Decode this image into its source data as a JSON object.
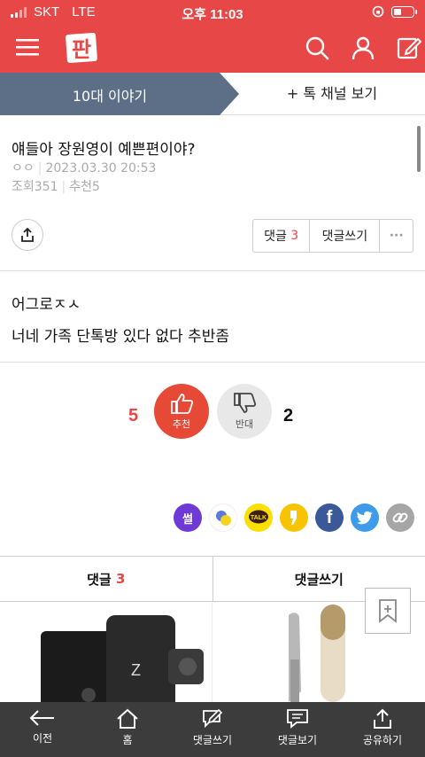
{
  "status": {
    "carrier": "SKT",
    "network": "LTE",
    "time": "오후 11:03"
  },
  "tabs": {
    "active": "10대 이야기",
    "other": "+ 톡 채널 보기"
  },
  "post": {
    "title": "얘들아 장원영이 예쁜편이야?",
    "author": "ㅇㅇ",
    "date": "2023.03.30 20:53",
    "views_label": "조회",
    "views": "351",
    "recommend_label": "추천",
    "recommend": "5",
    "body_line1": "어그로ㅈㅅ",
    "body_line2": "너네 가족 단톡방 있다 없다 추반좀"
  },
  "actions": {
    "comments_label": "댓글",
    "comments_count": "3",
    "write_comment": "댓글쓰기",
    "more": "···"
  },
  "votes": {
    "up_count": "5",
    "up_label": "추천",
    "down_count": "2",
    "down_label": "반대"
  },
  "socials": [
    {
      "name": "ssul",
      "label": "썰",
      "color": "#6e3ad7"
    },
    {
      "name": "band",
      "label": "",
      "color": "#ffffff"
    },
    {
      "name": "kakaotalk",
      "label": "TALK",
      "color": "#f9e000"
    },
    {
      "name": "kakaostory",
      "label": "",
      "color": "#f6c500"
    },
    {
      "name": "facebook",
      "label": "f",
      "color": "#3b5998"
    },
    {
      "name": "twitter",
      "label": "",
      "color": "#3d9be9"
    },
    {
      "name": "link",
      "label": "",
      "color": "#a6a6a6"
    }
  ],
  "comment_tabs": {
    "comments_label": "댓글",
    "comments_count": "3",
    "write_label": "댓글쓰기"
  },
  "bottom_nav": [
    {
      "label": "이전",
      "icon": "back-arrow-icon"
    },
    {
      "label": "홈",
      "icon": "home-icon"
    },
    {
      "label": "댓글쓰기",
      "icon": "write-comment-icon"
    },
    {
      "label": "댓글보기",
      "icon": "view-comment-icon"
    },
    {
      "label": "공유하기",
      "icon": "share-icon"
    }
  ],
  "colors": {
    "brand": "#e84747",
    "active_tab": "#5c6f87",
    "vote_up": "#e64a37",
    "bottom_bar": "#3c3c3c"
  }
}
